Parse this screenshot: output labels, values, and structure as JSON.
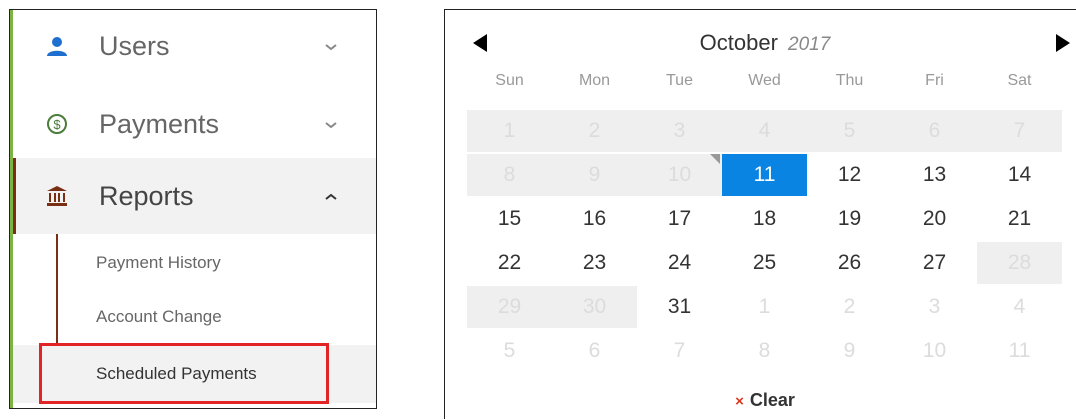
{
  "sidebar": {
    "items": [
      {
        "id": "users",
        "label": "Users",
        "icon": "user-icon",
        "expanded": false
      },
      {
        "id": "payments",
        "label": "Payments",
        "icon": "dollar-circle-icon",
        "expanded": false
      },
      {
        "id": "reports",
        "label": "Reports",
        "icon": "bank-icon",
        "expanded": true
      }
    ],
    "subitems": [
      {
        "id": "history",
        "label": "Payment History"
      },
      {
        "id": "account",
        "label": "Account Change"
      },
      {
        "id": "scheduled",
        "label": "Scheduled Payments",
        "highlighted": true
      }
    ],
    "colors": {
      "accent_green": "#7cb342",
      "reports_bar": "#7a2e14",
      "highlight": "#e22424",
      "user_icon": "#1e6fd0",
      "payments_icon": "#4a7c3a",
      "reports_icon": "#7a2e14"
    }
  },
  "calendar": {
    "month": "October",
    "year": "2017",
    "weekdays": [
      "Sun",
      "Mon",
      "Tue",
      "Wed",
      "Thu",
      "Fri",
      "Sat"
    ],
    "weeks": [
      [
        {
          "d": "1",
          "s": "disabled"
        },
        {
          "d": "2",
          "s": "disabled"
        },
        {
          "d": "3",
          "s": "disabled"
        },
        {
          "d": "4",
          "s": "disabled"
        },
        {
          "d": "5",
          "s": "disabled"
        },
        {
          "d": "6",
          "s": "disabled"
        },
        {
          "d": "7",
          "s": "disabled"
        }
      ],
      [
        {
          "d": "8",
          "s": "disabled"
        },
        {
          "d": "9",
          "s": "disabled"
        },
        {
          "d": "10",
          "s": "disabled",
          "today": true
        },
        {
          "d": "11",
          "s": "selected"
        },
        {
          "d": "12",
          "s": "normal"
        },
        {
          "d": "13",
          "s": "normal"
        },
        {
          "d": "14",
          "s": "normal"
        }
      ],
      [
        {
          "d": "15",
          "s": "normal"
        },
        {
          "d": "16",
          "s": "normal"
        },
        {
          "d": "17",
          "s": "normal"
        },
        {
          "d": "18",
          "s": "normal"
        },
        {
          "d": "19",
          "s": "normal"
        },
        {
          "d": "20",
          "s": "normal"
        },
        {
          "d": "21",
          "s": "normal"
        }
      ],
      [
        {
          "d": "22",
          "s": "normal"
        },
        {
          "d": "23",
          "s": "normal"
        },
        {
          "d": "24",
          "s": "normal"
        },
        {
          "d": "25",
          "s": "normal"
        },
        {
          "d": "26",
          "s": "normal"
        },
        {
          "d": "27",
          "s": "normal"
        },
        {
          "d": "28",
          "s": "disabled"
        }
      ],
      [
        {
          "d": "29",
          "s": "disabled"
        },
        {
          "d": "30",
          "s": "disabled"
        },
        {
          "d": "31",
          "s": "normal"
        },
        {
          "d": "1",
          "s": "out"
        },
        {
          "d": "2",
          "s": "out"
        },
        {
          "d": "3",
          "s": "out"
        },
        {
          "d": "4",
          "s": "out"
        }
      ],
      [
        {
          "d": "5",
          "s": "out"
        },
        {
          "d": "6",
          "s": "out"
        },
        {
          "d": "7",
          "s": "out"
        },
        {
          "d": "8",
          "s": "out"
        },
        {
          "d": "9",
          "s": "out"
        },
        {
          "d": "10",
          "s": "out"
        },
        {
          "d": "11",
          "s": "out"
        }
      ]
    ],
    "clear_label": "Clear",
    "clear_icon": "×",
    "colors": {
      "selected": "#0a84e3",
      "disabled_bg": "#efefef",
      "clear_x": "#d9381e"
    }
  }
}
